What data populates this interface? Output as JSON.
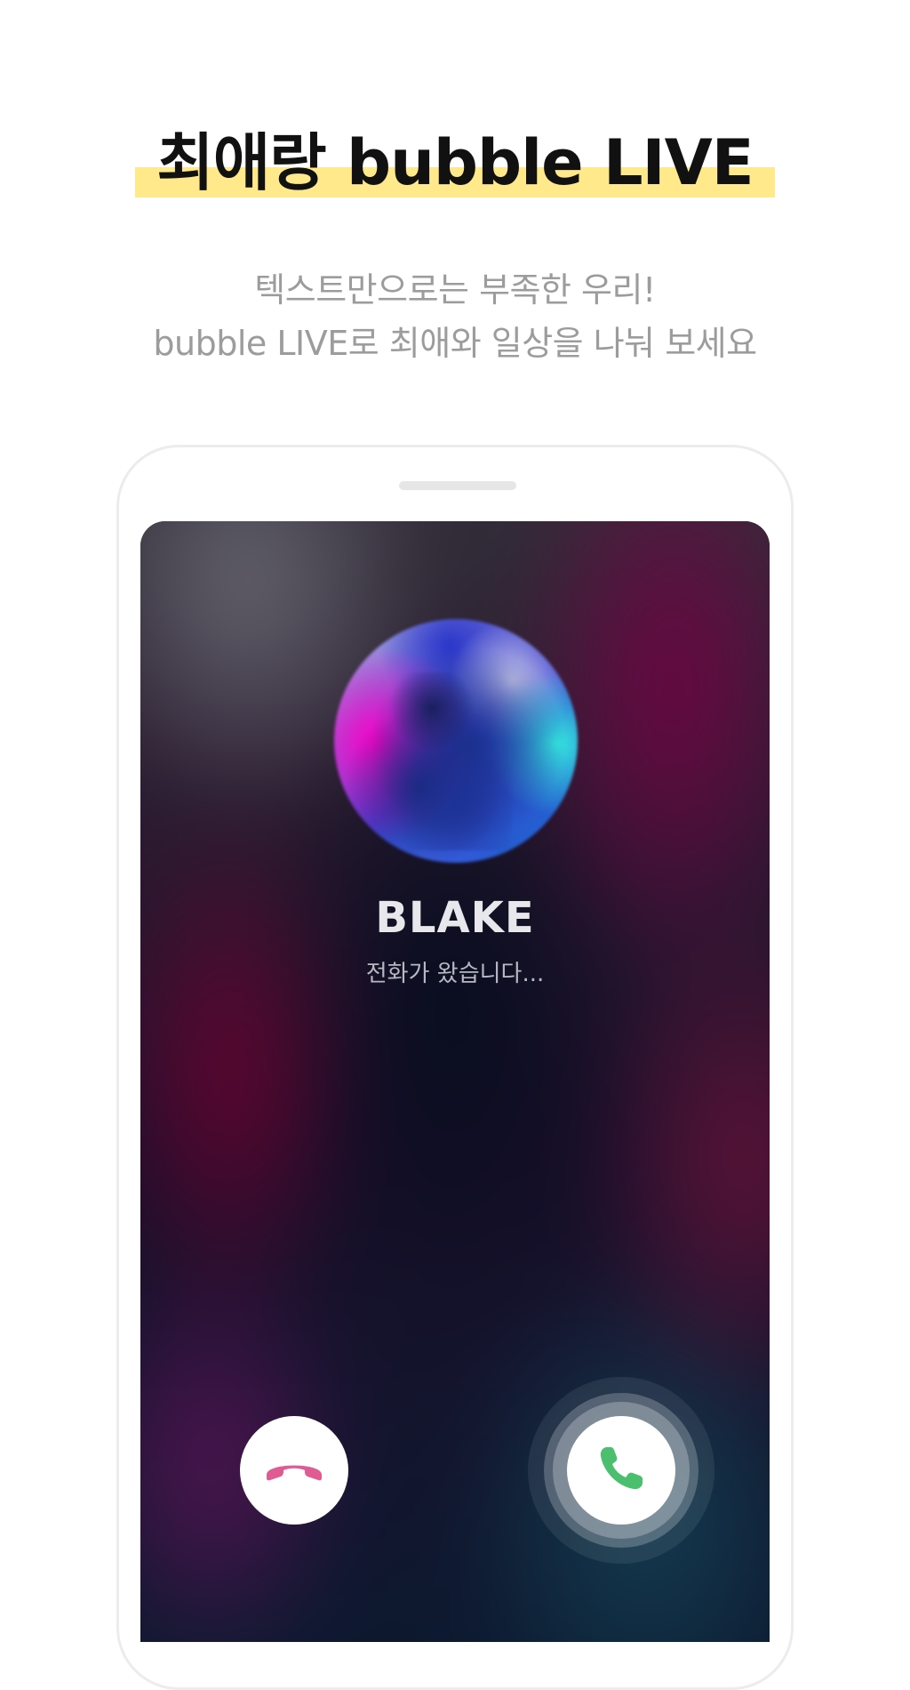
{
  "header": {
    "title": "최애랑 bubble LIVE",
    "subtitle_line1": "텍스트만으로는 부족한 우리!",
    "subtitle_line2": "bubble LIVE로 최애와 일상을 나눠 보세요"
  },
  "call": {
    "caller_name": "BLAKE",
    "status": "전화가 왔습니다..."
  },
  "colors": {
    "highlight": "#ffe98a",
    "decline_icon": "#e05a93",
    "accept_icon": "#4cbf6e"
  },
  "icons": {
    "decline": "phone-hangup-icon",
    "accept": "phone-icon"
  }
}
